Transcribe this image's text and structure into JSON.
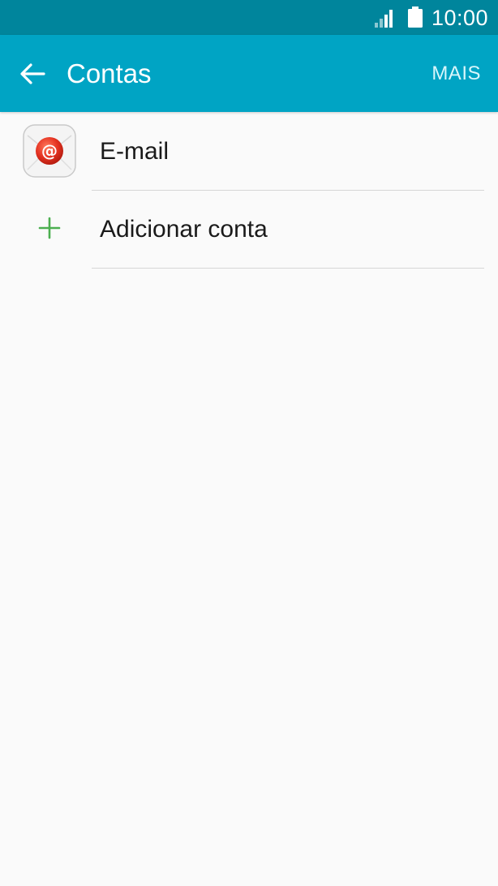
{
  "status_bar": {
    "time": "10:00",
    "icons": [
      "signal-icon",
      "battery-icon"
    ],
    "background": "#00859c"
  },
  "app_bar": {
    "title": "Contas",
    "more_label": "MAIS",
    "back_icon": "arrow-left-icon",
    "background": "#00a4c4"
  },
  "accounts": {
    "items": [
      {
        "label": "E-mail",
        "icon": "email-app-icon"
      },
      {
        "label": "Adicionar conta",
        "icon": "plus-icon",
        "icon_color": "#4caf50"
      }
    ]
  }
}
